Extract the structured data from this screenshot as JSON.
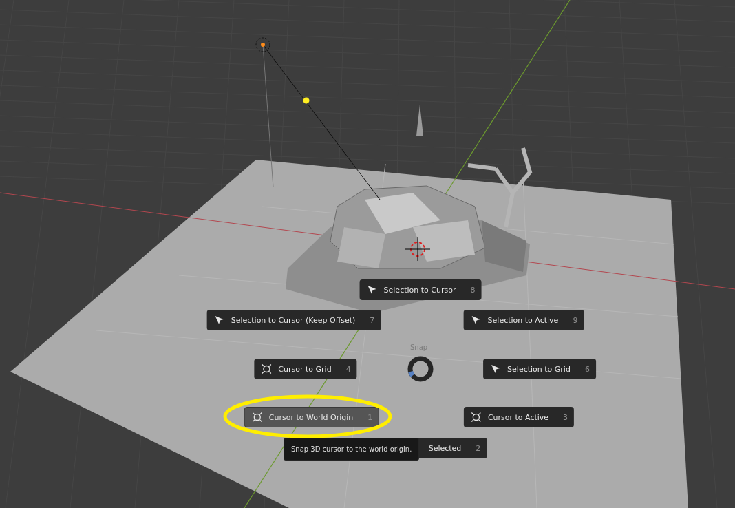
{
  "pie_menu": {
    "title": "Snap",
    "items": [
      {
        "label": "Selection to Cursor",
        "shortcut": "8",
        "kind": "selection",
        "selected": false
      },
      {
        "label": "Selection to Cursor (Keep Offset)",
        "shortcut": "7",
        "kind": "selection",
        "selected": false
      },
      {
        "label": "Selection to Active",
        "shortcut": "9",
        "kind": "selection",
        "selected": false
      },
      {
        "label": "Cursor to Grid",
        "shortcut": "4",
        "kind": "cursor",
        "selected": false
      },
      {
        "label": "Selection to Grid",
        "shortcut": "6",
        "kind": "selection",
        "selected": false
      },
      {
        "label": "Cursor to World Origin",
        "shortcut": "1",
        "kind": "cursor",
        "selected": true
      },
      {
        "label": "Cursor to Active",
        "shortcut": "3",
        "kind": "cursor",
        "selected": false
      },
      {
        "label": "Selected",
        "shortcut": "2",
        "selected": false
      }
    ]
  },
  "tooltip": {
    "text": "Snap 3D cursor to the world origin."
  }
}
